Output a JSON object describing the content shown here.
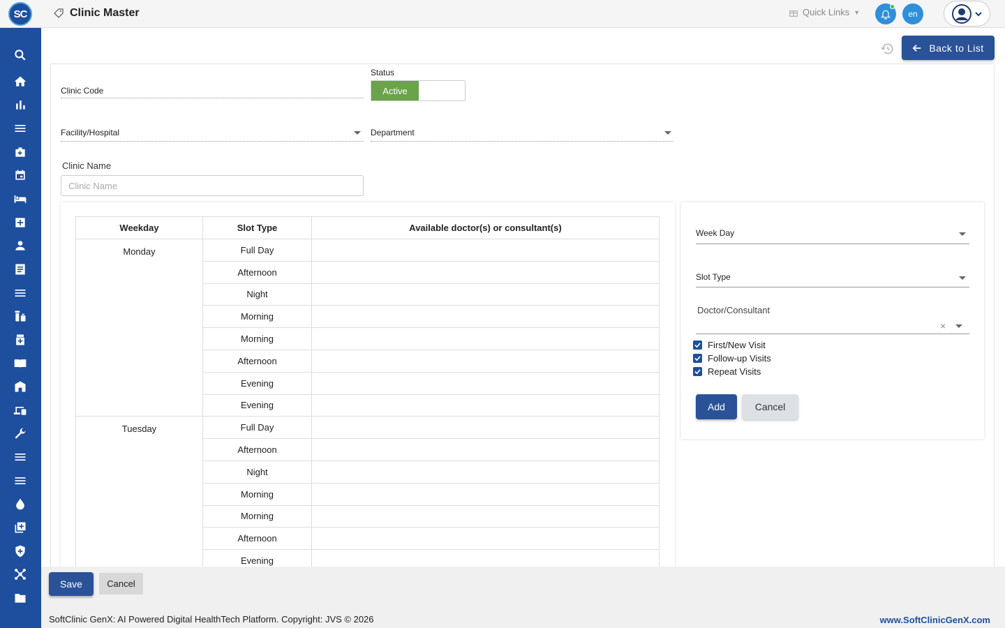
{
  "app": {
    "logo_text": "SC",
    "title": "Clinic Master"
  },
  "header": {
    "quick_links": "Quick Links",
    "lang": "en"
  },
  "sidebar": {
    "items": [
      "search-icon",
      "home-icon",
      "bar-chart-icon",
      "menu-icon",
      "briefcase-medical-icon",
      "calendar-icon",
      "bed-icon",
      "plus-square-icon",
      "user-icon",
      "document-icon",
      "list-icon",
      "pharmacy-icon",
      "medicine-box-icon",
      "book-icon",
      "building-icon",
      "devices-icon",
      "wrench-icon",
      "list-icon",
      "list-icon",
      "drop-icon",
      "add-box-icon",
      "shield-icon",
      "network-icon",
      "folder-icon"
    ]
  },
  "toolbar": {
    "back_label": "Back to List"
  },
  "form": {
    "clinic_code_label": "Clinic Code",
    "status_label": "Status",
    "status_value": "Active",
    "facility_label": "Facility/Hospital",
    "department_label": "Department",
    "clinic_name_label": "Clinic Name",
    "clinic_name_placeholder": "Clinic Name"
  },
  "schedule": {
    "headers": [
      "Weekday",
      "Slot Type",
      "Available doctor(s) or consultant(s)"
    ],
    "groups": [
      {
        "day": "Monday",
        "slots": [
          "Full Day",
          "Afternoon",
          "Night",
          "Morning",
          "Morning",
          "Afternoon",
          "Evening",
          "Evening"
        ]
      },
      {
        "day": "Tuesday",
        "slots": [
          "Full Day",
          "Afternoon",
          "Night",
          "Morning",
          "Morning",
          "Afternoon",
          "Evening"
        ]
      }
    ]
  },
  "slot_form": {
    "week_day_label": "Week Day",
    "slot_type_label": "Slot Type",
    "doctor_label": "Doctor/Consultant",
    "checkboxes": [
      "First/New Visit",
      "Follow-up Visits",
      "Repeat Visits"
    ],
    "add_label": "Add",
    "cancel_label": "Cancel"
  },
  "actions": {
    "save_label": "Save",
    "cancel_label": "Cancel"
  },
  "footer": {
    "copyright": "SoftClinic GenX: AI Powered Digital HealthTech Platform. Copyright: JVS © 2026",
    "url": "www.SoftClinicGenX.com"
  },
  "colors": {
    "primary": "#1d4f9e",
    "button": "#2a5298",
    "active_toggle": "#6aa34a",
    "notif": "#2f8fd8"
  }
}
